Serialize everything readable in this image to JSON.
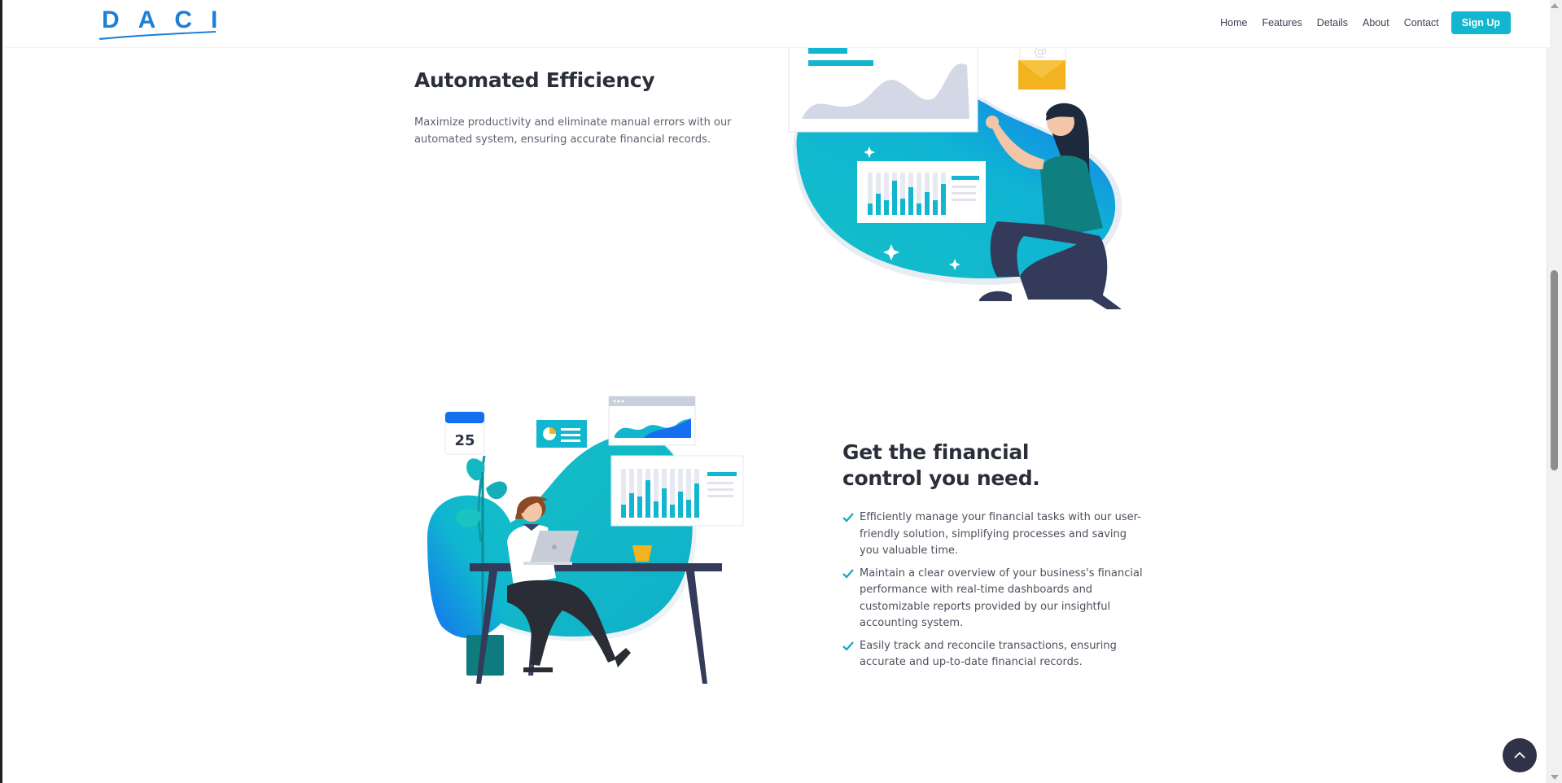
{
  "header": {
    "logo_text": "DACI",
    "nav": [
      "Home",
      "Features",
      "Details",
      "About",
      "Contact"
    ],
    "signup_label": "Sign Up"
  },
  "section1": {
    "title": "Automated Efficiency",
    "text": "Maximize productivity and eliminate manual errors with our automated system, ensuring accurate financial records."
  },
  "section2": {
    "title": "Get the financial control you need.",
    "bullets": [
      "Efficiently manage your financial tasks with our user-friendly solution, simplifying processes and saving you valuable time.",
      "Maintain a clear overview of your business's financial performance with real-time dashboards and customizable reports provided by our insightful accounting system.",
      "Easily track and reconcile transactions, ensuring accurate and up-to-date financial records."
    ],
    "calendar_day": "25"
  },
  "colors": {
    "brand_blue": "#1e7fd6",
    "accent_teal": "#13b6cf",
    "dark_navy": "#2e3348",
    "check_teal": "#11a7bf"
  },
  "icons": {
    "back_to_top": "chevron-up-icon",
    "bullet": "check-icon"
  }
}
